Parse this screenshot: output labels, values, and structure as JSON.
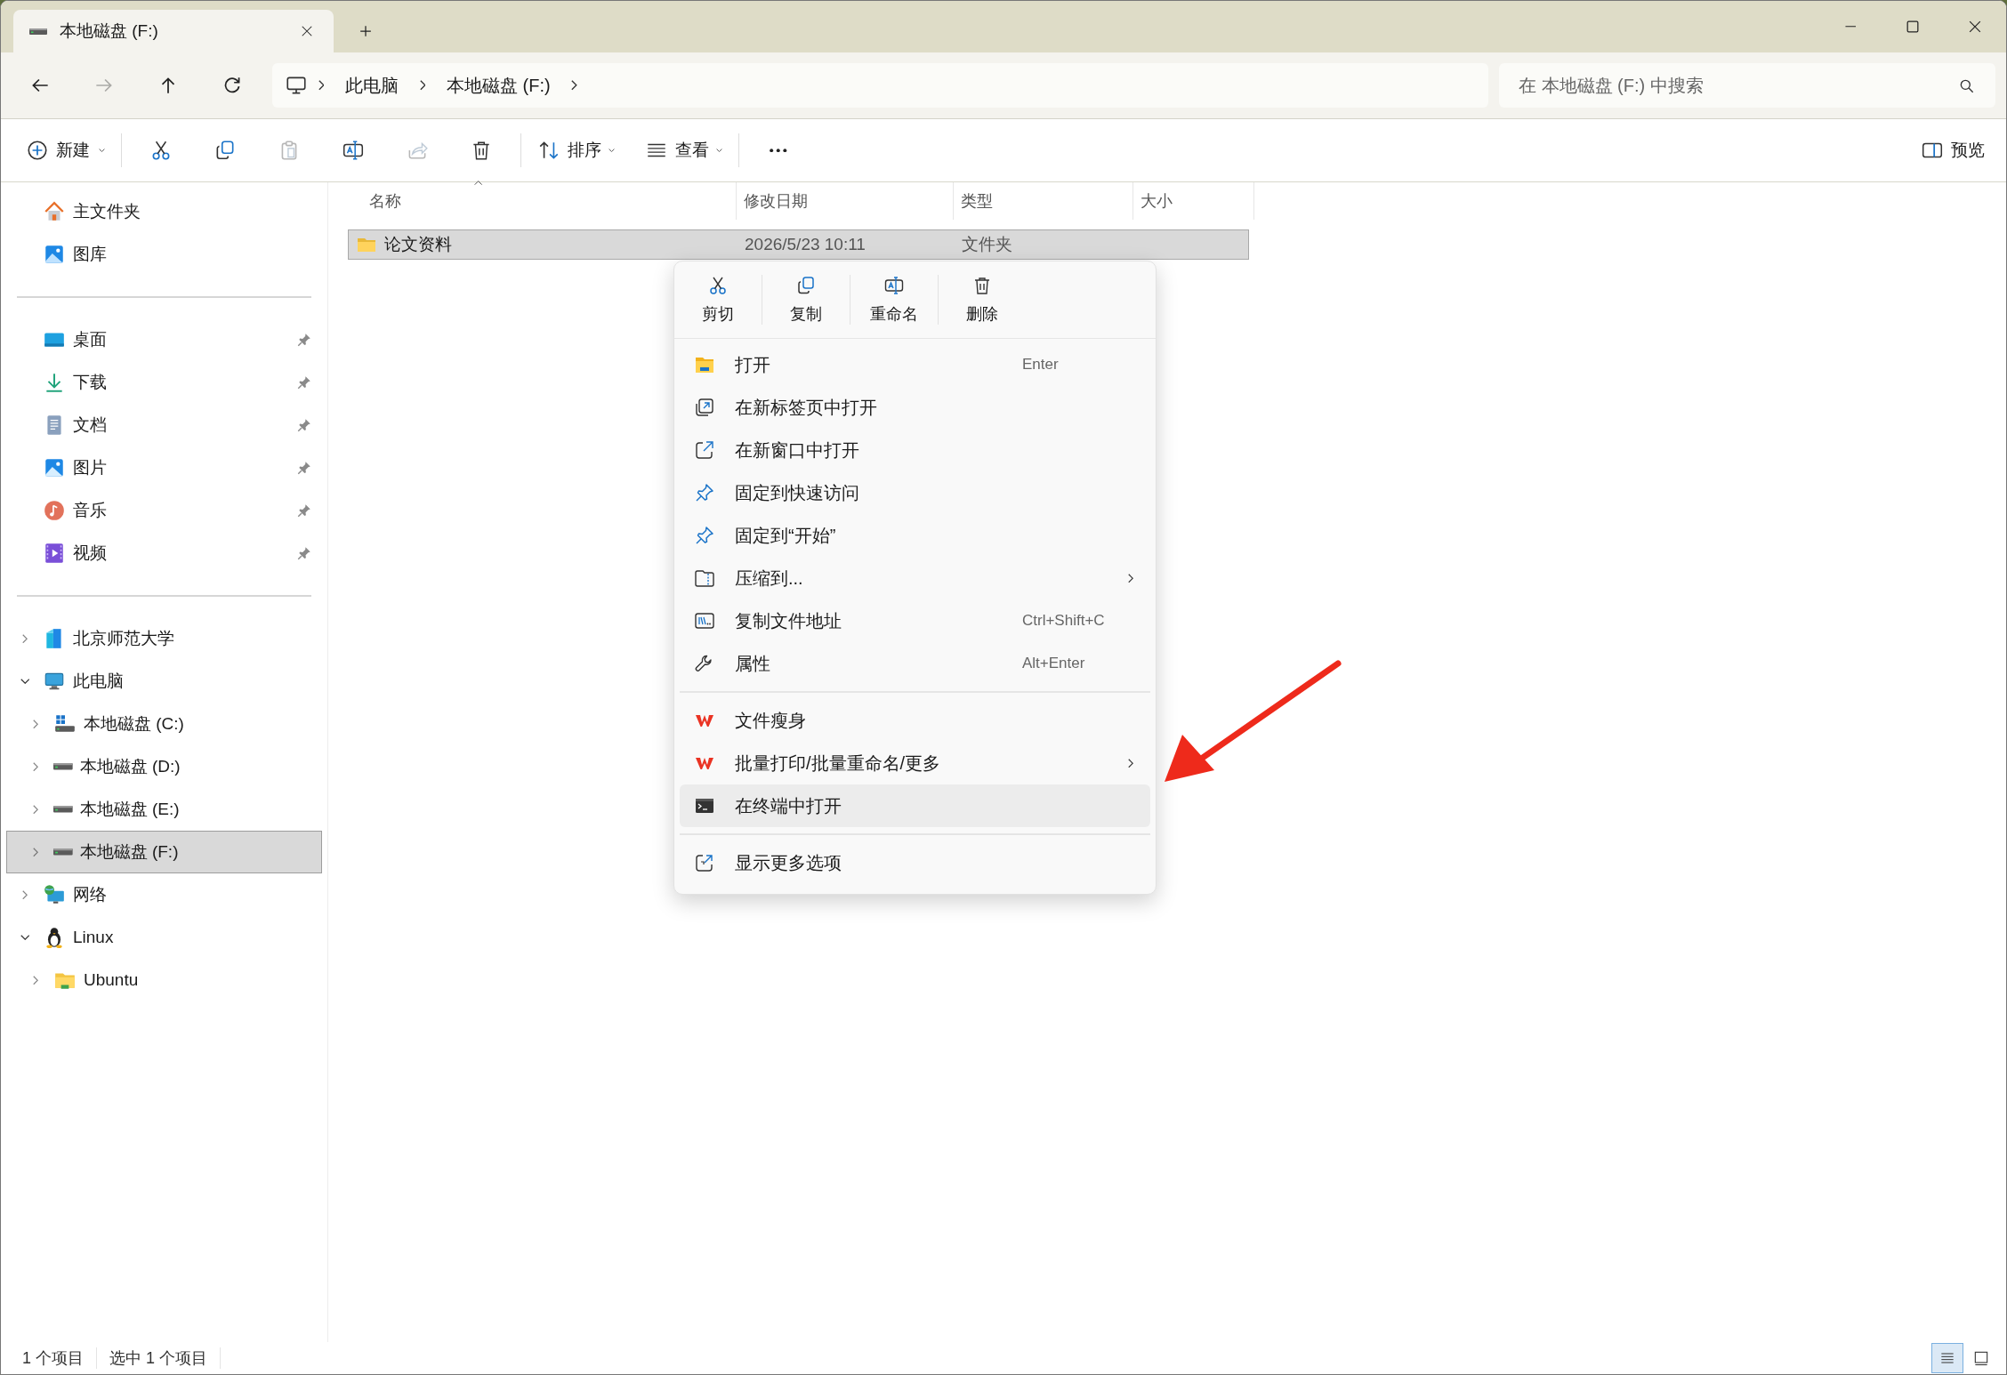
{
  "window": {
    "tab_title": "本地磁盘 (F:)"
  },
  "navigation": [
    {
      "kind": "back",
      "disabled": false
    },
    {
      "kind": "forward",
      "disabled": true
    },
    {
      "kind": "up",
      "disabled": false
    },
    {
      "kind": "refresh",
      "disabled": false
    }
  ],
  "address": {
    "crumbs": [
      "此电脑",
      "本地磁盘 (F:)"
    ]
  },
  "search": {
    "placeholder": "在 本地磁盘 (F:) 中搜索"
  },
  "toolbar": {
    "new_label": "新建",
    "sort_label": "排序",
    "view_label": "查看",
    "preview_label": "预览",
    "tools": [
      {
        "kind": "cut",
        "disabled": false
      },
      {
        "kind": "copy",
        "disabled": false
      },
      {
        "kind": "paste",
        "disabled": true
      },
      {
        "kind": "rename",
        "disabled": false
      },
      {
        "kind": "share",
        "disabled": true
      },
      {
        "kind": "delete",
        "disabled": false
      }
    ]
  },
  "sidebar": {
    "groups": [
      [
        {
          "label": "主文件夹",
          "kind": "home",
          "pinned": false
        },
        {
          "label": "图库",
          "kind": "gallery",
          "pinned": false
        }
      ],
      [
        {
          "label": "桌面",
          "kind": "desktop",
          "pinned": true
        },
        {
          "label": "下载",
          "kind": "downloads",
          "pinned": true
        },
        {
          "label": "文档",
          "kind": "documents",
          "pinned": true
        },
        {
          "label": "图片",
          "kind": "pictures",
          "pinned": true
        },
        {
          "label": "音乐",
          "kind": "music",
          "pinned": true
        },
        {
          "label": "视频",
          "kind": "videos",
          "pinned": true
        }
      ],
      [
        {
          "label": "北京师范大学",
          "kind": "cloud",
          "expanded": false,
          "selected": false
        },
        {
          "label": "此电脑",
          "kind": "pc",
          "expanded": true,
          "selected": false,
          "children": [
            {
              "label": "本地磁盘 (C:)",
              "kind": "drive_os",
              "expanded": false,
              "selected": false
            },
            {
              "label": "本地磁盘 (D:)",
              "kind": "drive",
              "expanded": false,
              "selected": false
            },
            {
              "label": "本地磁盘 (E:)",
              "kind": "drive",
              "expanded": false,
              "selected": false
            },
            {
              "label": "本地磁盘 (F:)",
              "kind": "drive",
              "expanded": false,
              "selected": true
            }
          ]
        },
        {
          "label": "网络",
          "kind": "network",
          "expanded": false,
          "selected": false
        },
        {
          "label": "Linux",
          "kind": "linux",
          "expanded": true,
          "selected": false,
          "children": [
            {
              "label": "Ubuntu",
              "kind": "folder",
              "expanded": false,
              "selected": false
            }
          ]
        }
      ]
    ]
  },
  "table": {
    "columns": [
      {
        "label": "名称",
        "sorted": true
      },
      {
        "label": "修改日期",
        "sorted": false
      },
      {
        "label": "类型",
        "sorted": false
      },
      {
        "label": "大小",
        "sorted": false
      }
    ],
    "rows": [
      {
        "name": "论文资料",
        "modified": "2026/5/23 10:11",
        "type": "文件夹",
        "selected": true
      }
    ]
  },
  "context_menu": {
    "quick_actions": [
      {
        "label": "剪切",
        "kind": "cut"
      },
      {
        "label": "复制",
        "kind": "copy"
      },
      {
        "label": "重命名",
        "kind": "rename"
      },
      {
        "label": "删除",
        "kind": "delete"
      }
    ],
    "sections": [
      [
        {
          "label": "打开",
          "kind": "open",
          "shortcut": "Enter",
          "submenu": false,
          "highlighted": false
        },
        {
          "label": "在新标签页中打开",
          "kind": "newtab",
          "submenu": false,
          "highlighted": false
        },
        {
          "label": "在新窗口中打开",
          "kind": "newwindow",
          "submenu": false,
          "highlighted": false
        },
        {
          "label": "固定到快速访问",
          "kind": "pin",
          "submenu": false,
          "highlighted": false
        },
        {
          "label": "固定到“开始”",
          "kind": "pin",
          "submenu": false,
          "highlighted": false
        },
        {
          "label": "压缩到...",
          "kind": "zip",
          "submenu": true,
          "highlighted": false
        },
        {
          "label": "复制文件地址",
          "kind": "path",
          "shortcut": "Ctrl+Shift+C",
          "submenu": false,
          "highlighted": false
        },
        {
          "label": "属性",
          "kind": "wrench",
          "shortcut": "Alt+Enter",
          "submenu": false,
          "highlighted": false
        }
      ],
      [
        {
          "label": "文件瘦身",
          "kind": "wps",
          "submenu": false,
          "highlighted": false
        },
        {
          "label": "批量打印/批量重命名/更多",
          "kind": "wps",
          "submenu": true,
          "highlighted": false
        },
        {
          "label": "在终端中打开",
          "kind": "terminal",
          "submenu": false,
          "highlighted": true
        }
      ],
      [
        {
          "label": "显示更多选项",
          "kind": "more",
          "submenu": false,
          "highlighted": false
        }
      ]
    ]
  },
  "pointer_arrow": true,
  "status_bar": {
    "count": "1 个项目",
    "selection": "选中 1 个项目",
    "view_modes": [
      {
        "kind": "details",
        "selected": true
      },
      {
        "kind": "tiles",
        "selected": false
      }
    ]
  }
}
